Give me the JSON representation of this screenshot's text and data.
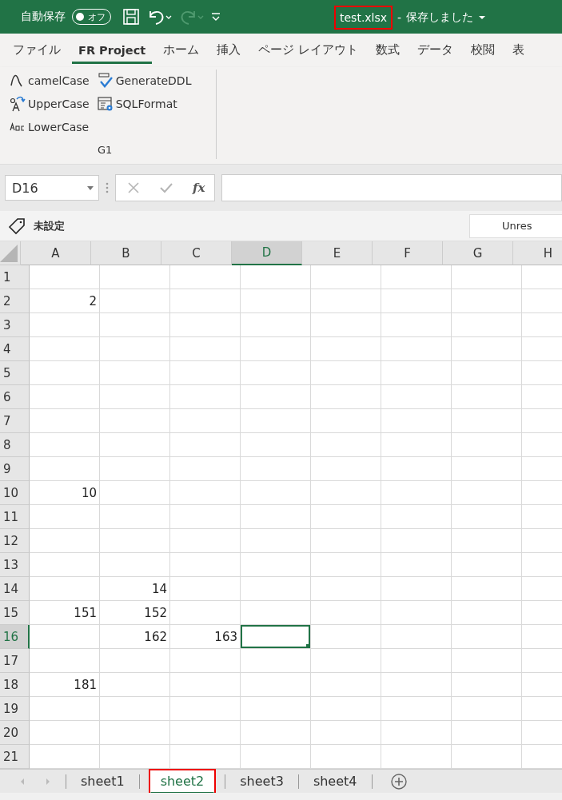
{
  "title_bar": {
    "autosave_label": "自動保存",
    "autosave_toggle": {
      "label": "オフ",
      "on": false
    },
    "file_name": "test.xlsx",
    "file_name_highlighted": true,
    "separator": "-",
    "save_status": "保存しました"
  },
  "ribbon_tabs": [
    {
      "label": "ファイル",
      "selected": false
    },
    {
      "label": "FR Project",
      "selected": true
    },
    {
      "label": "ホーム",
      "selected": false
    },
    {
      "label": "挿入",
      "selected": false
    },
    {
      "label": "ページ レイアウト",
      "selected": false
    },
    {
      "label": "数式",
      "selected": false
    },
    {
      "label": "データ",
      "selected": false
    },
    {
      "label": "校閲",
      "selected": false
    },
    {
      "label": "表",
      "selected": false
    }
  ],
  "ribbon_group": {
    "name": "G1",
    "buttons": [
      {
        "label": "camelCase",
        "kind": "curve"
      },
      {
        "label": "UpperCase",
        "kind": "case"
      },
      {
        "label": "LowerCase",
        "kind": "abc"
      },
      {
        "label": "GenerateDDL",
        "kind": "sqlcheck"
      },
      {
        "label": "SQLFormat",
        "kind": "sqlformat"
      }
    ]
  },
  "formula_bar": {
    "name_box": "D16",
    "function_label": "fx"
  },
  "sensitivity_bar": {
    "label": "未設定",
    "field_value": "Unres"
  },
  "sheet": {
    "columns": [
      {
        "label": "A",
        "selected": false
      },
      {
        "label": "B",
        "selected": false
      },
      {
        "label": "C",
        "selected": false
      },
      {
        "label": "D",
        "selected": true
      },
      {
        "label": "E",
        "selected": false
      },
      {
        "label": "F",
        "selected": false
      },
      {
        "label": "G",
        "selected": false
      },
      {
        "label": "H",
        "selected": false
      }
    ],
    "rows": [
      {
        "label": "1",
        "selected": false
      },
      {
        "label": "2",
        "selected": false,
        "cells": {
          "A": "2"
        }
      },
      {
        "label": "3",
        "selected": false
      },
      {
        "label": "4",
        "selected": false
      },
      {
        "label": "5",
        "selected": false
      },
      {
        "label": "6",
        "selected": false
      },
      {
        "label": "7",
        "selected": false
      },
      {
        "label": "8",
        "selected": false
      },
      {
        "label": "9",
        "selected": false
      },
      {
        "label": "10",
        "selected": false,
        "cells": {
          "A": "10"
        }
      },
      {
        "label": "11",
        "selected": false
      },
      {
        "label": "12",
        "selected": false
      },
      {
        "label": "13",
        "selected": false
      },
      {
        "label": "14",
        "selected": false,
        "cells": {
          "B": "14"
        }
      },
      {
        "label": "15",
        "selected": false,
        "cells": {
          "A": "151",
          "B": "152"
        }
      },
      {
        "label": "16",
        "selected": true,
        "cells": {
          "B": "162",
          "C": "163"
        }
      },
      {
        "label": "17",
        "selected": false
      },
      {
        "label": "18",
        "selected": false,
        "cells": {
          "A": "181"
        }
      },
      {
        "label": "19",
        "selected": false
      },
      {
        "label": "20",
        "selected": false
      },
      {
        "label": "21",
        "selected": false
      }
    ]
  },
  "sheet_tabs": [
    {
      "label": "sheet1",
      "selected": false,
      "highlighted": false
    },
    {
      "label": "sheet2",
      "selected": true,
      "highlighted": true
    },
    {
      "label": "sheet3",
      "selected": false,
      "highlighted": false
    },
    {
      "label": "sheet4",
      "selected": false,
      "highlighted": false
    }
  ]
}
